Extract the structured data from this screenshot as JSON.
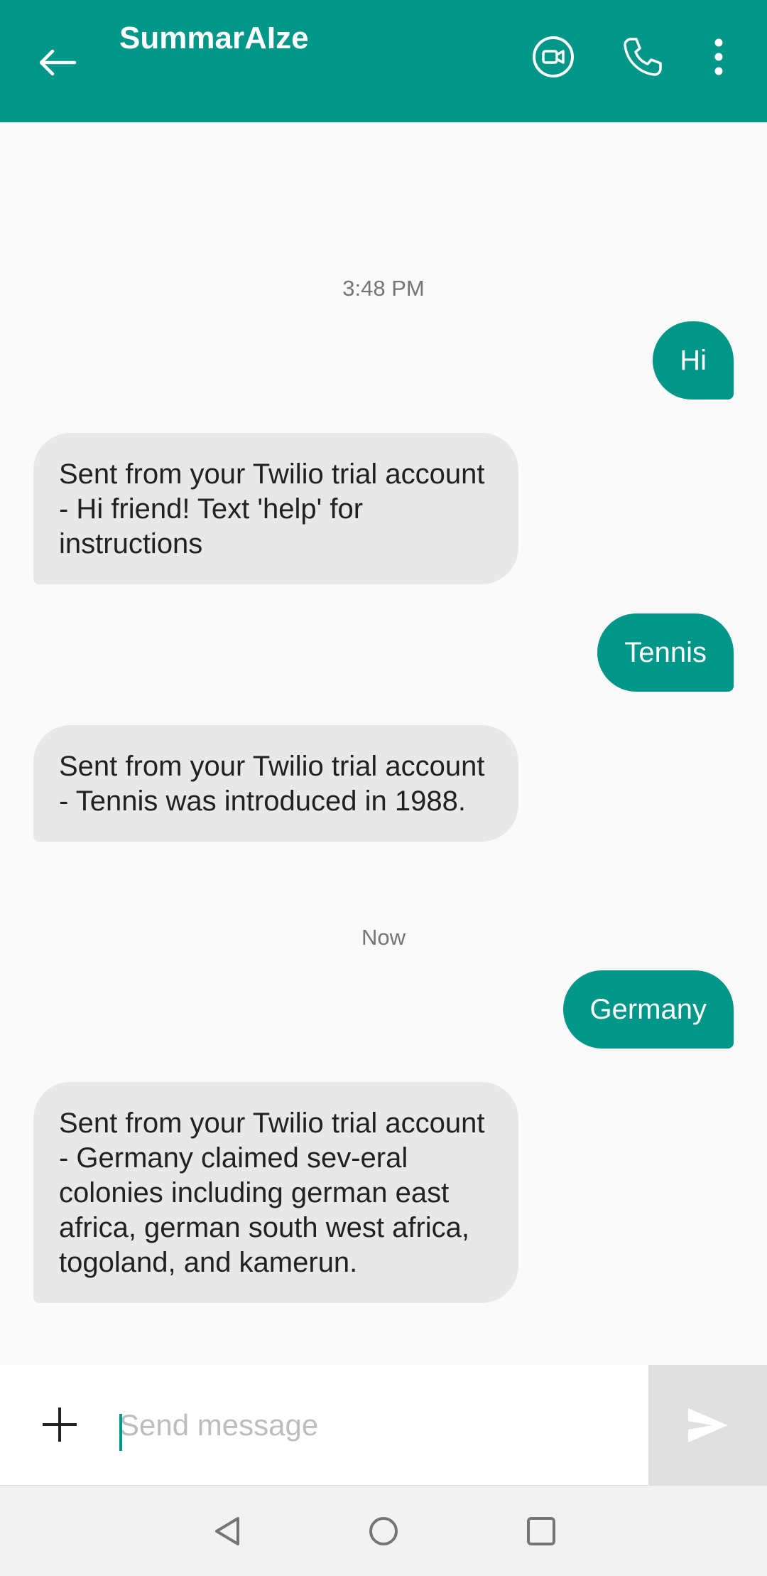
{
  "header": {
    "title": "SummarAIze",
    "back_icon": "arrow-left-icon",
    "video_icon": "video-call-icon",
    "call_icon": "phone-icon",
    "more_icon": "more-vert-icon",
    "color": "#009688"
  },
  "messages": [
    {
      "type": "timestamp",
      "text": "3:48 PM"
    },
    {
      "type": "outgoing",
      "text": "Hi"
    },
    {
      "type": "incoming",
      "text": "Sent from your Twilio trial account - Hi friend! Text 'help' for instructions"
    },
    {
      "type": "outgoing",
      "text": "Tennis"
    },
    {
      "type": "incoming",
      "text": "Sent from your Twilio trial account - Tennis was introduced in 1988."
    },
    {
      "type": "timestamp",
      "text": "Now"
    },
    {
      "type": "outgoing",
      "text": "Germany"
    },
    {
      "type": "incoming",
      "text": "Sent from your Twilio trial account - Germany claimed sev-eral colonies including german east africa, german south west africa, togoland, and kamerun."
    }
  ],
  "composer": {
    "placeholder": "Send message",
    "value": "",
    "attach_icon": "plus-icon",
    "send_icon": "send-icon"
  },
  "navbar": {
    "back_icon": "nav-back-icon",
    "home_icon": "nav-home-icon",
    "recents_icon": "nav-recents-icon"
  },
  "colors": {
    "accent": "#009688",
    "incoming_bubble": "#e8e8e8",
    "background": "#fafafa"
  }
}
